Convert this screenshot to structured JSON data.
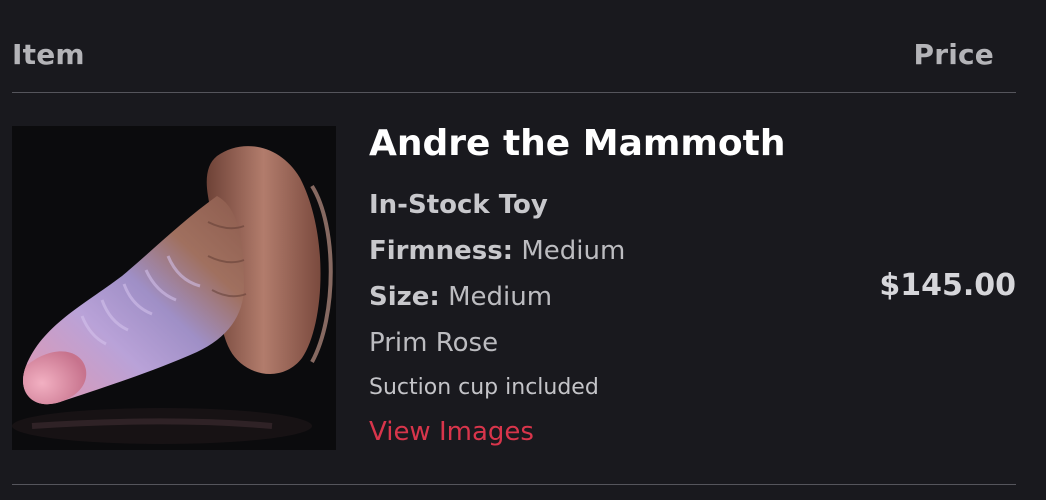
{
  "table_header": {
    "item_label": "Item",
    "price_label": "Price"
  },
  "cart_item": {
    "image_alt": "Andre the Mammoth product photo",
    "title": "Andre the Mammoth",
    "stock_status": "In-Stock Toy",
    "firmness_label": "Firmness:",
    "firmness_value": "Medium",
    "size_label": "Size:",
    "size_value": "Medium",
    "colorway": "Prim Rose",
    "accessory_note": "Suction cup included",
    "view_images_label": "View Images",
    "price": "$145.00"
  },
  "colors": {
    "background": "#19191e",
    "accent_link": "#d8354b",
    "title": "#ffffff"
  }
}
